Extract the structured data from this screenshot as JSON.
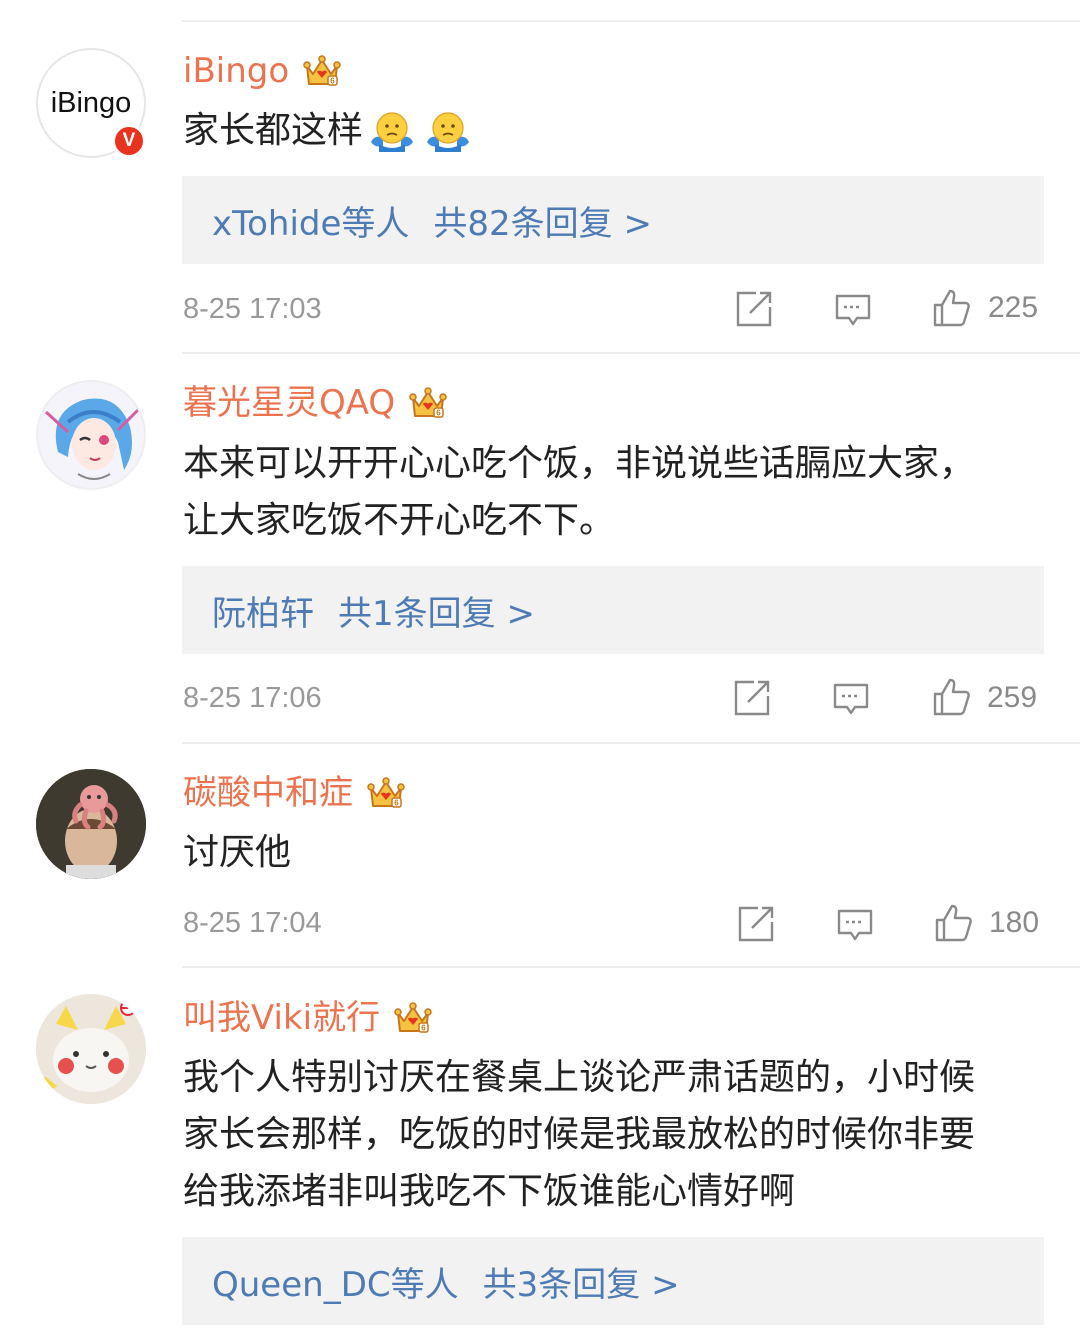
{
  "comments": [
    {
      "avatar_text": "iBingo",
      "verified_badge": "V",
      "username": "iBingo",
      "text": "家长都这样",
      "reply_who": "xTohide等人",
      "reply_count": "共82条回复 >",
      "time": "8-25 17:03",
      "likes": "225"
    },
    {
      "username": "暮光星灵QAQ",
      "text_lines": [
        "本来可以开开心心吃个饭，非说说些话膈应大家，",
        "让大家吃饭不开心吃不下。"
      ],
      "reply_who": "阮柏轩",
      "reply_count": "共1条回复 >",
      "time": "8-25 17:06",
      "likes": "259"
    },
    {
      "username": "碳酸中和症",
      "text": "讨厌他",
      "time": "8-25 17:04",
      "likes": "180"
    },
    {
      "username": "叫我Viki就行",
      "text_lines": [
        "我个人特别讨厌在餐桌上谈论严肃话题的，小时候",
        "家长会那样，吃饭的时候是我最放松的时候你非要",
        "给我添堵非叫我吃不下饭谁能心情好啊"
      ],
      "reply_who": "Queen_DC等人",
      "reply_count": "共3条回复 >",
      "time": "",
      "likes": ""
    }
  ],
  "icons": {
    "crown": "crown-badge-icon",
    "shrug": "shrug-emoji-icon",
    "repost": "repost-icon",
    "comment": "comment-icon",
    "like": "thumbs-up-icon"
  },
  "colors": {
    "username": "#eb7350",
    "reply_link": "#4e7bb4",
    "reply_bg": "#f2f2f2",
    "meta": "#999999",
    "verified": "#e8331f"
  }
}
